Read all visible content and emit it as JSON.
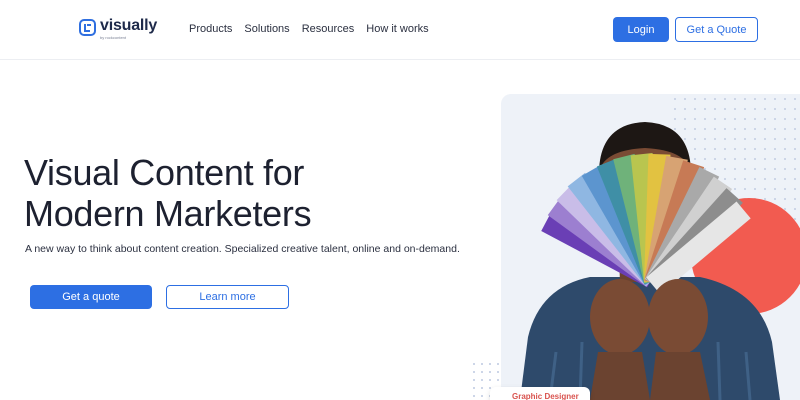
{
  "header": {
    "logo": {
      "name": "visually",
      "tagline": "by rockcontent"
    },
    "nav": [
      {
        "label": "Products"
      },
      {
        "label": "Solutions"
      },
      {
        "label": "Resources"
      },
      {
        "label": "How it works"
      }
    ],
    "login_label": "Login",
    "quote_label": "Get a Quote"
  },
  "hero": {
    "title_line1": "Visual Content for",
    "title_line2": "Modern Marketers",
    "subtitle": "A new way to think about content creation. Specialized creative talent, online and on-demand.",
    "cta_primary": "Get a quote",
    "cta_secondary": "Learn more"
  },
  "art": {
    "card_text": "Graphic Designer",
    "accent_color": "#f25b50",
    "brand_color": "#2d6fe3"
  }
}
